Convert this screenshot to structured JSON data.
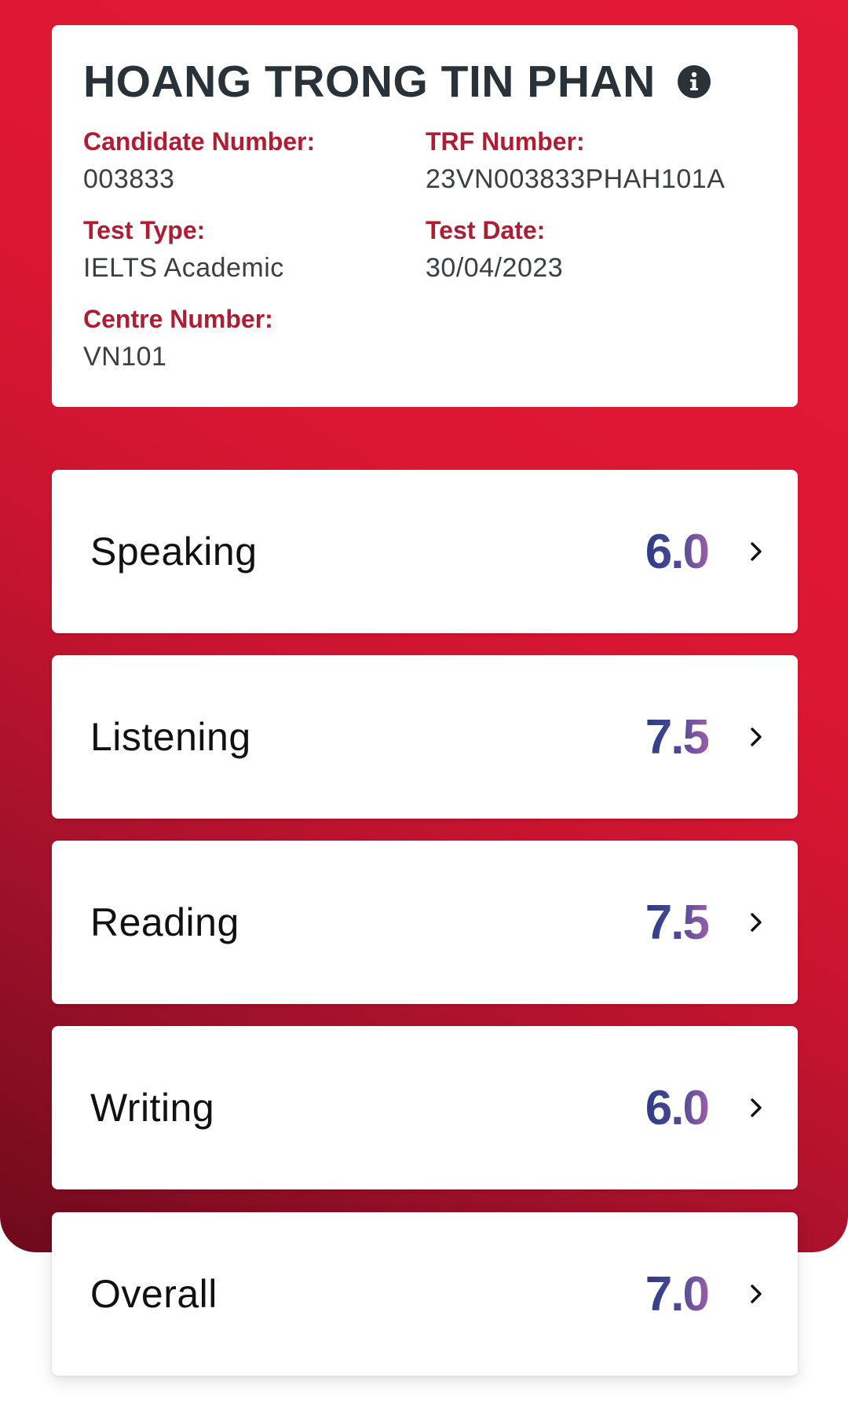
{
  "candidate": {
    "name": "HOANG TRONG TIN PHAN",
    "info_icon": "info-icon"
  },
  "fields": {
    "candidate_number": {
      "label": "Candidate Number:",
      "value": "003833"
    },
    "trf_number": {
      "label": "TRF Number:",
      "value": "23VN003833PHAH101A"
    },
    "test_type": {
      "label": "Test Type:",
      "value": "IELTS Academic"
    },
    "test_date": {
      "label": "Test Date:",
      "value": "30/04/2023"
    },
    "centre_number": {
      "label": "Centre Number:",
      "value": "VN101"
    }
  },
  "scores": [
    {
      "label": "Speaking",
      "value": "6.0"
    },
    {
      "label": "Listening",
      "value": "7.5"
    },
    {
      "label": "Reading",
      "value": "7.5"
    },
    {
      "label": "Writing",
      "value": "6.0"
    },
    {
      "label": "Overall",
      "value": "7.0"
    }
  ],
  "colors": {
    "brand_red": "#e31936",
    "label_red": "#b01c32",
    "score_gradient_start": "#2b3c84",
    "score_gradient_end": "#9a5ea8"
  }
}
